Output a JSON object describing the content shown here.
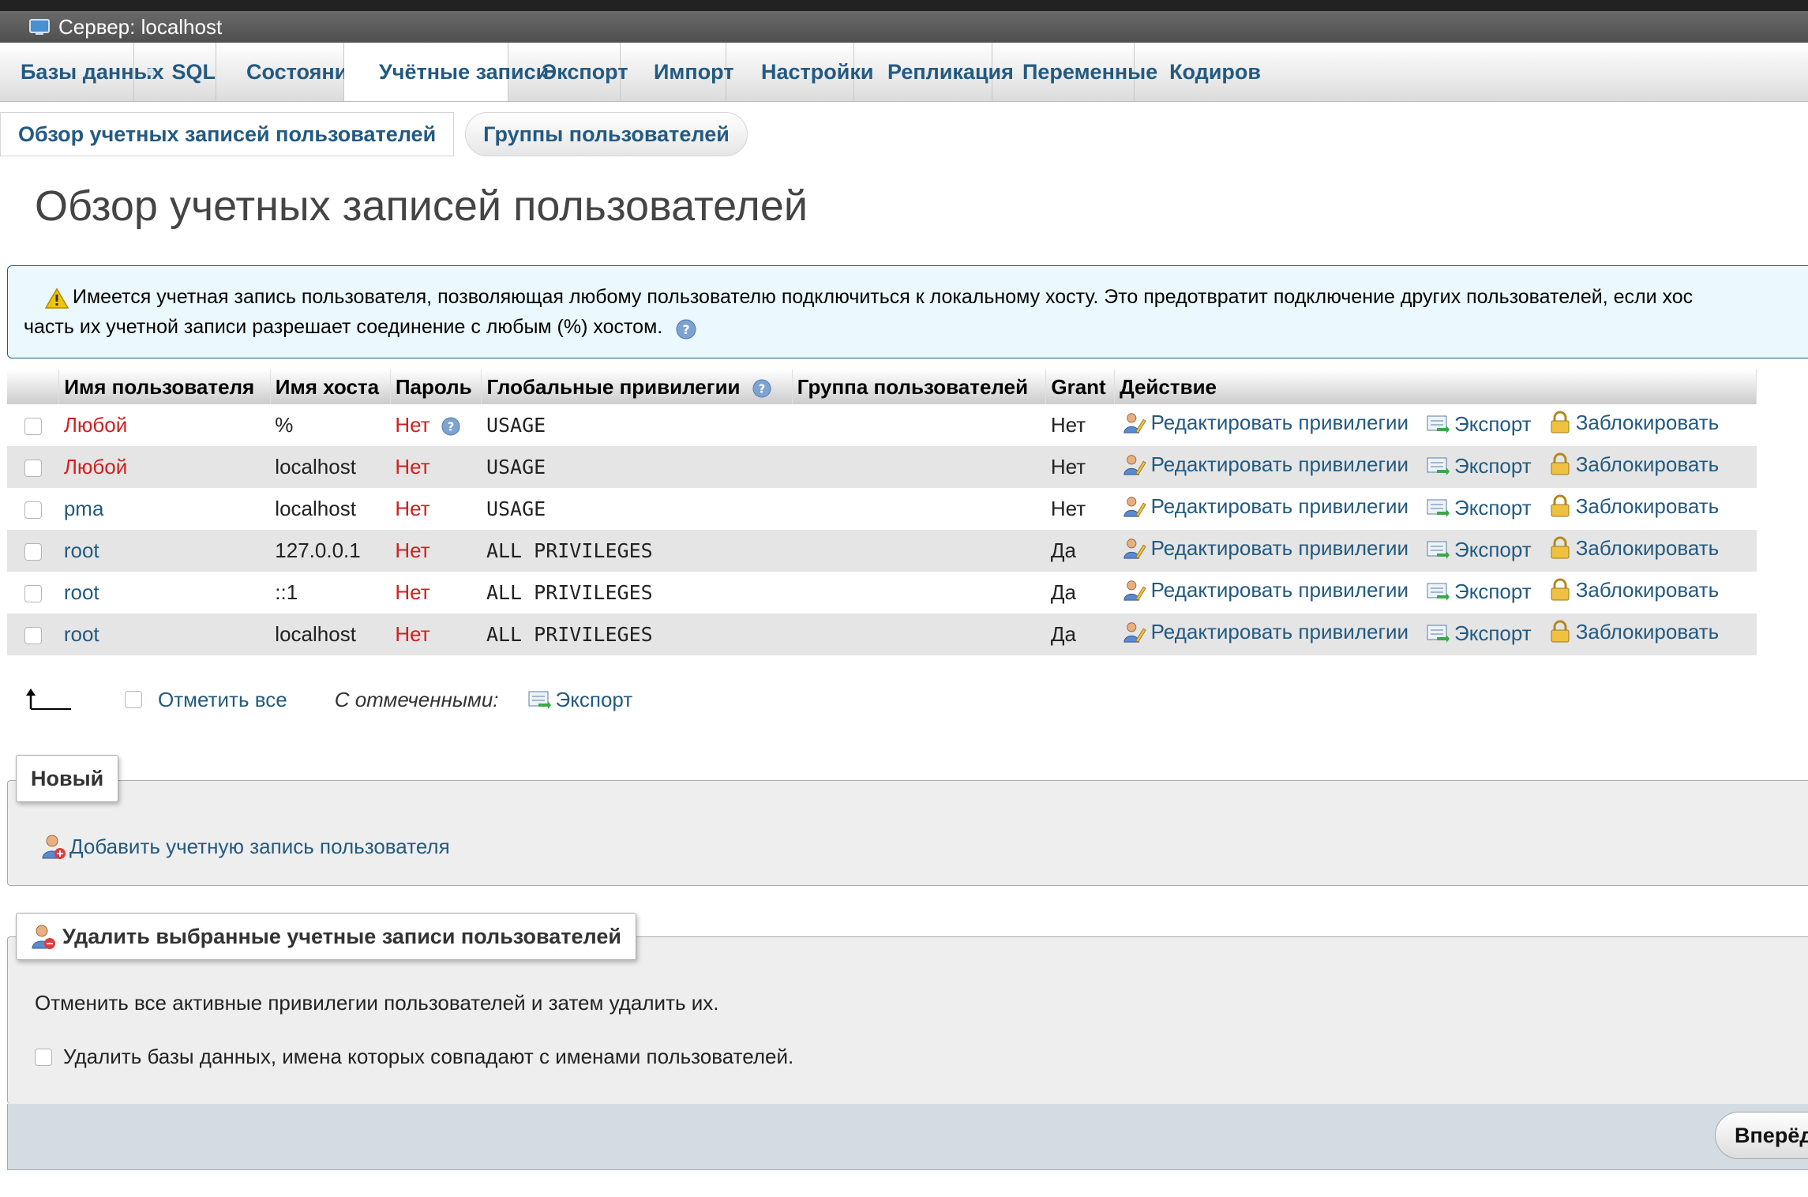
{
  "server_bar": {
    "title": "Сервер: localhost"
  },
  "nav_tabs": [
    {
      "label": "Базы данных",
      "icon": "database-icon"
    },
    {
      "label": "SQL",
      "icon": "sql-icon"
    },
    {
      "label": "Состояние",
      "icon": "status-icon"
    },
    {
      "label": "Учётные записи",
      "icon": "users-icon",
      "active": true
    },
    {
      "label": "Экспорт",
      "icon": "export-icon"
    },
    {
      "label": "Импорт",
      "icon": "import-icon"
    },
    {
      "label": "Настройки",
      "icon": "wrench-icon"
    },
    {
      "label": "Репликация",
      "icon": "replication-icon"
    },
    {
      "label": "Переменные",
      "icon": "variables-icon"
    },
    {
      "label": "Кодиров",
      "icon": "charset-icon"
    }
  ],
  "sub_tabs": {
    "overview": "Обзор учетных записей пользователей",
    "groups": "Группы пользователей"
  },
  "page_title": "Обзор учетных записей пользователей",
  "notice": {
    "line1": "Имеется учетная запись пользователя, позволяющая любому пользователю подключиться к локальному хосту. Это предотвратит подключение других пользователей, если хос",
    "line2": "часть их учетной записи разрешает соединение с любым (%) хостом."
  },
  "table": {
    "headers": {
      "user": "Имя пользователя",
      "host": "Имя хоста",
      "password": "Пароль",
      "privileges": "Глобальные привилегии",
      "group": "Группа пользователей",
      "grant": "Grant",
      "action": "Действие"
    },
    "rows": [
      {
        "user": "Любой",
        "user_any": true,
        "host": "%",
        "password": "Нет",
        "privileges": "USAGE",
        "group": "",
        "grant": "Нет"
      },
      {
        "user": "Любой",
        "user_any": true,
        "host": "localhost",
        "password": "Нет",
        "privileges": "USAGE",
        "group": "",
        "grant": "Нет"
      },
      {
        "user": "pma",
        "user_any": false,
        "host": "localhost",
        "password": "Нет",
        "privileges": "USAGE",
        "group": "",
        "grant": "Нет"
      },
      {
        "user": "root",
        "user_any": false,
        "host": "127.0.0.1",
        "password": "Нет",
        "privileges": "ALL PRIVILEGES",
        "group": "",
        "grant": "Да"
      },
      {
        "user": "root",
        "user_any": false,
        "host": "::1",
        "password": "Нет",
        "privileges": "ALL PRIVILEGES",
        "group": "",
        "grant": "Да"
      },
      {
        "user": "root",
        "user_any": false,
        "host": "localhost",
        "password": "Нет",
        "privileges": "ALL PRIVILEGES",
        "group": "",
        "grant": "Да"
      }
    ],
    "actions": {
      "edit": "Редактировать привилегии",
      "export": "Экспорт",
      "lock": "Заблокировать"
    }
  },
  "bulk": {
    "check_all": "Отметить все",
    "with_selected": "С отмеченными:",
    "export": "Экспорт"
  },
  "new_section": {
    "legend": "Новый",
    "add_user": "Добавить учетную запись пользователя"
  },
  "delete_section": {
    "legend": "Удалить выбранные учетные записи пользователей",
    "description": "Отменить все активные привилегии пользователей и затем удалить их.",
    "drop_db_label": "Удалить базы данных, имена которых совпадают с именами пользователей.",
    "go_button": "Вперёд"
  },
  "colors": {
    "link": "#235a81",
    "red": "#d02020",
    "notice_bg": "#ebf8fd",
    "notice_border": "#1a5e8e",
    "footer_bg": "#d3dce3"
  }
}
